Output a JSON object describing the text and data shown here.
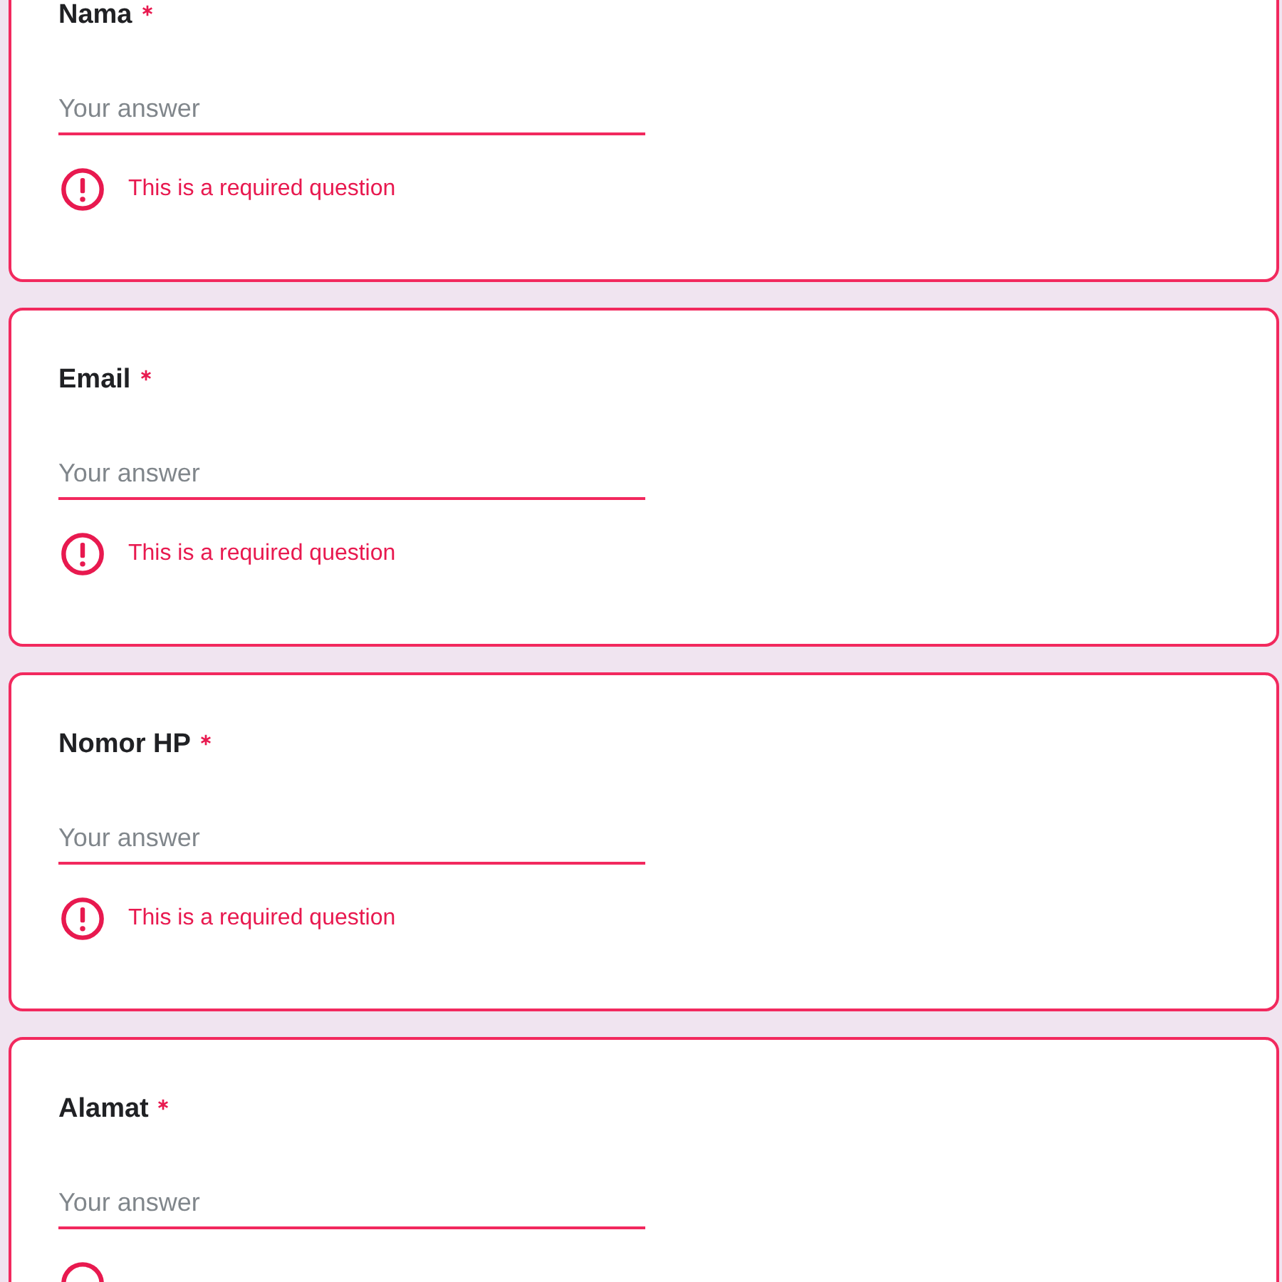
{
  "questions": [
    {
      "title": "Nama",
      "required": true,
      "placeholder": "Your answer",
      "error": true,
      "error_message": "This is a required question"
    },
    {
      "title": "Email",
      "required": true,
      "placeholder": "Your answer",
      "error": true,
      "error_message": "This is a required question"
    },
    {
      "title": "Nomor HP",
      "required": true,
      "placeholder": "Your answer",
      "error": true,
      "error_message": "This is a required question"
    },
    {
      "title": "Alamat",
      "required": true,
      "placeholder": "Your answer",
      "error": true
    }
  ]
}
